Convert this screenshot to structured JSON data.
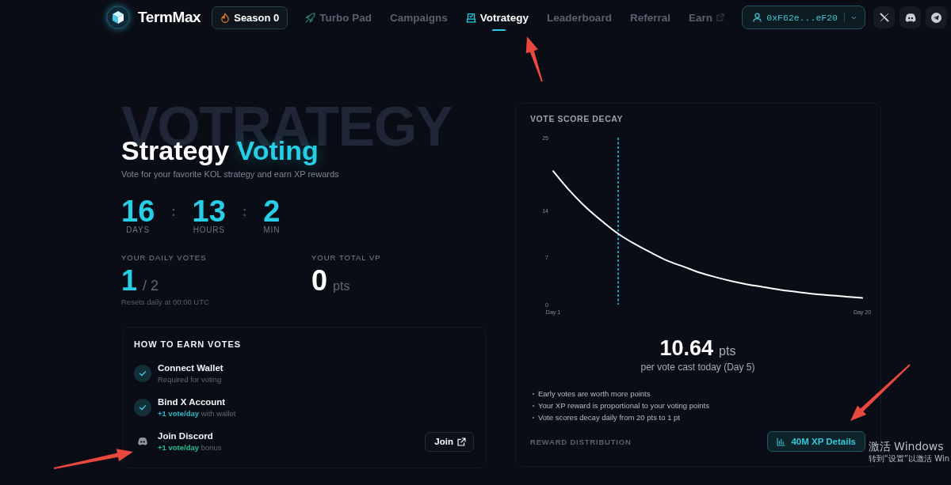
{
  "nav": {
    "brand": "TermMax",
    "season": "Season 0",
    "items": [
      {
        "label": "Turbo Pad",
        "kind": "launch",
        "selected": false
      },
      {
        "label": "Campaigns",
        "kind": "page",
        "selected": false
      },
      {
        "label": "Votrategy",
        "kind": "vote",
        "selected": true
      },
      {
        "label": "Leaderboard",
        "kind": "page",
        "selected": false
      },
      {
        "label": "Referral",
        "kind": "page",
        "selected": false
      },
      {
        "label": "Earn",
        "kind": "external",
        "selected": false
      }
    ],
    "wallet": "0xF62e...eF20"
  },
  "hero": {
    "background_word": "VOTRATEGY",
    "title": "Strategy",
    "title_accent": "Voting",
    "subtitle": "Vote for your favorite KOL strategy and earn XP rewards"
  },
  "countdown": {
    "separator": ":",
    "units": [
      {
        "value": "16",
        "label": "DAYS"
      },
      {
        "value": "13",
        "label": "HOURS"
      },
      {
        "value": "2",
        "label": "MIN"
      }
    ]
  },
  "stats": [
    {
      "kind": "votes",
      "label": "YOUR DAILY VOTES",
      "value": "1",
      "suffix": "/ 2",
      "note": "Resets daily at 00:00 UTC"
    },
    {
      "kind": "points",
      "label": "YOUR TOTAL VP",
      "value": "0",
      "suffix": "pts"
    }
  ],
  "earn_votes": {
    "title": "HOW TO EARN VOTES",
    "tasks": [
      {
        "title": "Connect Wallet",
        "note": "Required for voting",
        "completed": true
      },
      {
        "title": "Bind X Account",
        "bonus": "+1 vote/day",
        "note": "with wallet",
        "completed": true
      },
      {
        "title": "Join Discord",
        "bonus": "+1 vote/day",
        "note": "bonus",
        "completed": false,
        "action": "Join"
      }
    ]
  },
  "decay": {
    "title": "VOTE SCORE DECAY",
    "chart_data": {
      "type": "line",
      "categories": [
        "Day 1",
        null,
        null,
        null,
        null,
        null,
        null,
        null,
        null,
        null,
        null,
        null,
        null,
        null,
        null,
        null,
        null,
        null,
        null,
        "Day 20"
      ],
      "values": [
        20,
        17.1,
        14.6,
        12.5,
        10.6,
        9.1,
        7.8,
        6.6,
        5.7,
        4.8,
        4.1,
        3.5,
        3,
        2.6,
        2.2,
        1.9,
        1.6,
        1.4,
        1.2,
        1
      ],
      "ylim": [
        0,
        25
      ],
      "yticks": [
        0,
        7,
        14,
        25
      ]
    },
    "score": "10.64",
    "score_unit": "pts",
    "caption": "per vote cast today (Day 5)",
    "notes": [
      "Early votes are worth more points",
      "Your XP reward is proportional to your voting points",
      "Vote scores decay daily from 20 pts to 1 pt"
    ],
    "reward_label": "REWARD DISTRIBUTION",
    "details_button": "40M XP Details"
  },
  "activation_notice": {
    "title": "激活 Windows",
    "subtitle": "转到“设置”以激活 Win"
  }
}
